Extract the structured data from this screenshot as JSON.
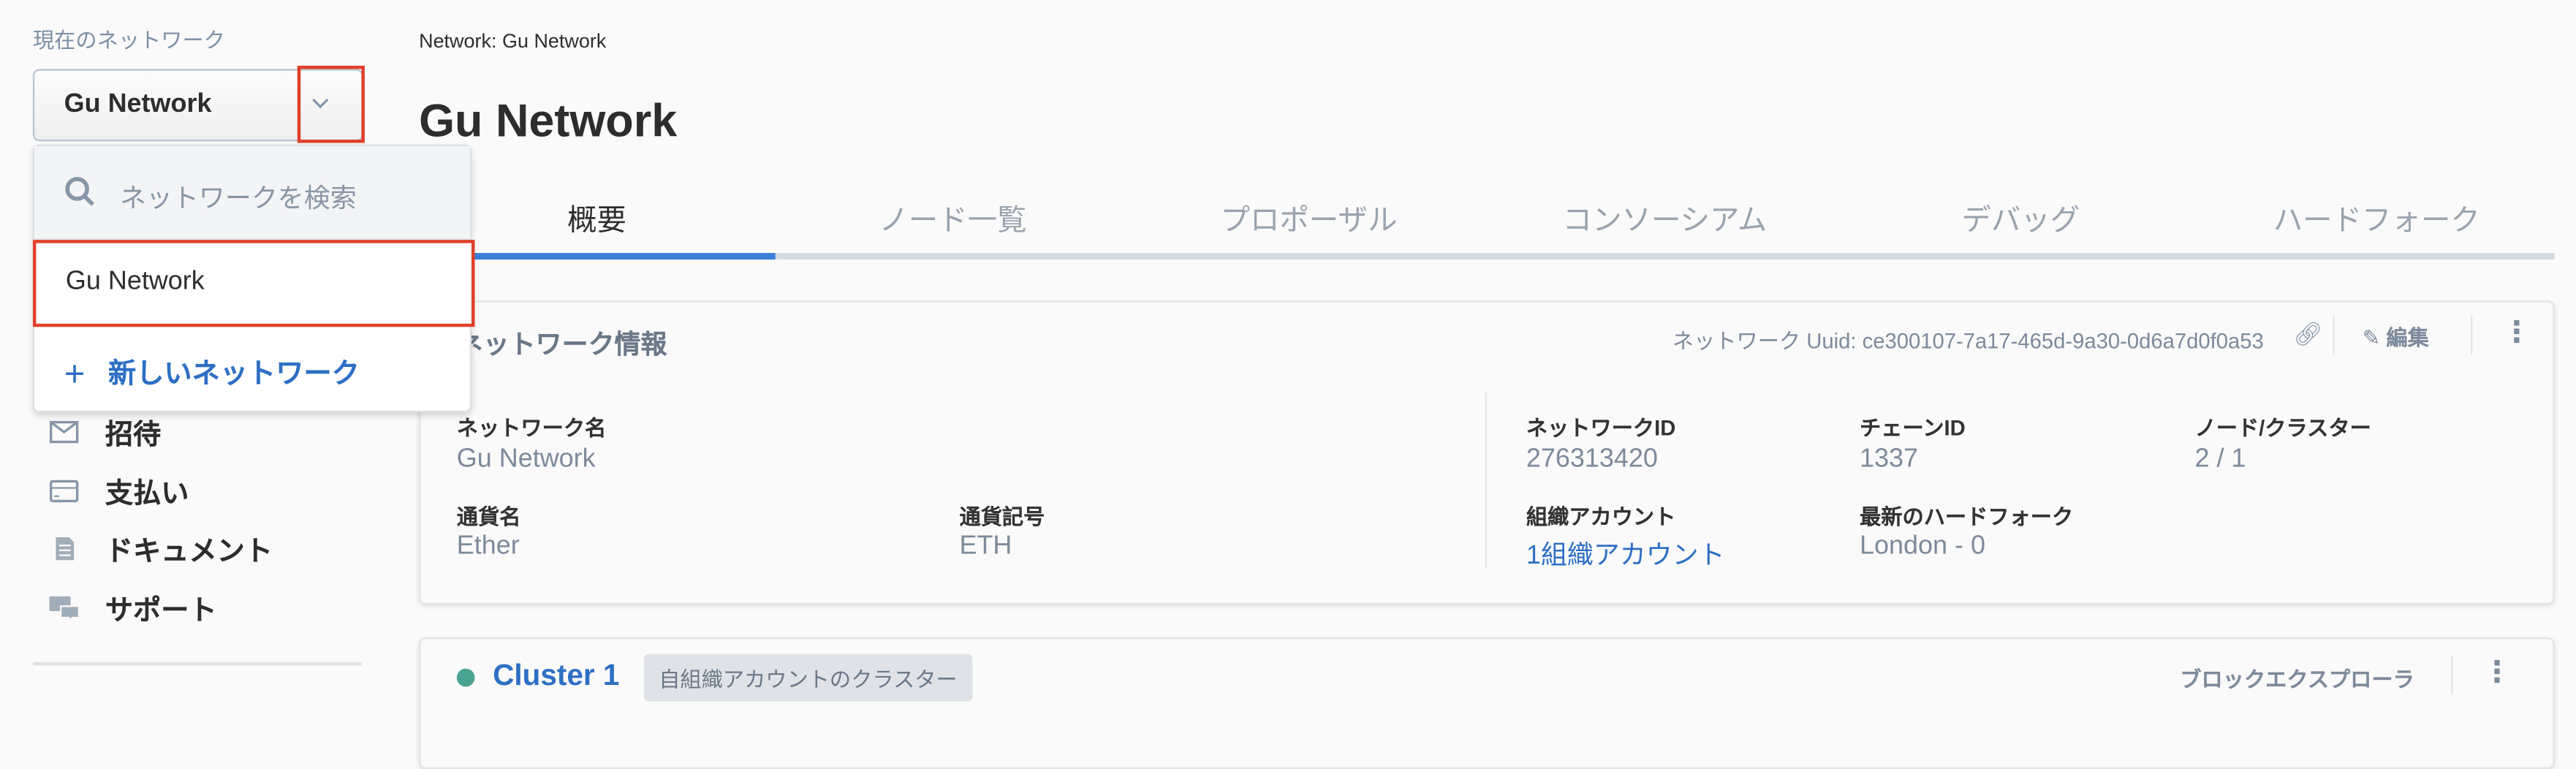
{
  "sidebar": {
    "current_label": "現在のネットワーク",
    "selected": "Gu Network",
    "dropdown": {
      "search_placeholder": "ネットワークを検索",
      "items": [
        "Gu Network"
      ],
      "new_label": "新しいネットワーク"
    },
    "nav": [
      {
        "label": "招待",
        "icon": "mail-icon"
      },
      {
        "label": "支払い",
        "icon": "credit-card-icon"
      },
      {
        "label": "ドキュメント",
        "icon": "document-icon"
      },
      {
        "label": "サポート",
        "icon": "chat-icon"
      }
    ]
  },
  "main": {
    "breadcrumb": "Network: Gu Network",
    "title": "Gu Network",
    "tabs": [
      "概要",
      "ノード一覧",
      "プロポーザル",
      "コンソーシアム",
      "デバッグ",
      "ハードフォーク"
    ],
    "info_card": {
      "title": "ネットワーク情報",
      "uuid": "ネットワーク Uuid: ce300107-7a17-465d-9a30-0d6a7d0f0a53",
      "edit": "編集",
      "fields": {
        "name_label": "ネットワーク名",
        "name": "Gu Network",
        "currency_label": "通貨名",
        "currency": "Ether",
        "symbol_label": "通貨記号",
        "symbol": "ETH",
        "network_id_label": "ネットワークID",
        "network_id": "276313420",
        "chain_id_label": "チェーンID",
        "chain_id": "1337",
        "nodes_label": "ノード/クラスター",
        "nodes": "2 / 1",
        "org_label": "組織アカウント",
        "org": "1組織アカウント",
        "fork_label": "最新のハードフォーク",
        "fork": "London - 0"
      }
    },
    "cluster_card": {
      "name": "Cluster 1",
      "badge": "自組織アカウントのクラスター",
      "explorer": "ブロックエクスプローラ",
      "status_color": "#4aa391"
    }
  },
  "colors": {
    "accent": "#3b7fd8",
    "highlight": "#e0402a"
  }
}
